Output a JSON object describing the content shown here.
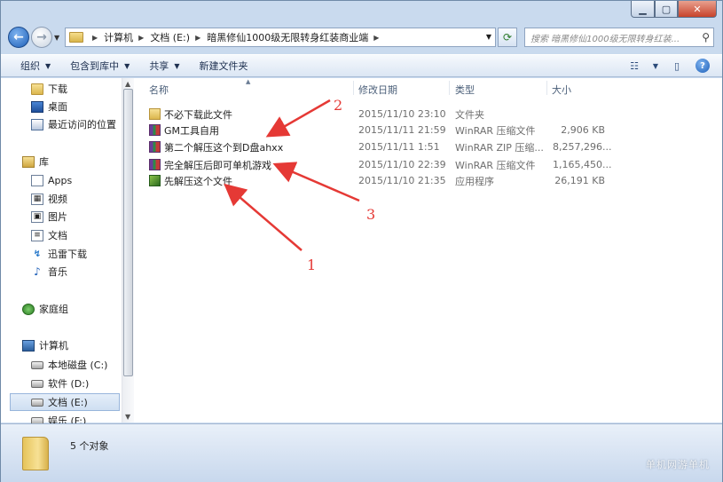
{
  "window": {
    "min_icon": "minimize-icon",
    "max_icon": "maximize-icon",
    "close_icon": "close-icon"
  },
  "nav": {
    "breadcrumbs": [
      "计算机",
      "文档 (E:)",
      "暗黑修仙1000级无限转身红装商业端"
    ],
    "search_placeholder": "搜索 暗黑修仙1000级无限转身红装..."
  },
  "toolbar": {
    "organize": "组织",
    "include_in_library": "包含到库中",
    "share": "共享",
    "new_folder": "新建文件夹"
  },
  "sidebar": {
    "downloads": "下载",
    "desktop": "桌面",
    "recent": "最近访问的位置",
    "libraries": "库",
    "apps": "Apps",
    "videos": "视频",
    "pictures": "图片",
    "documents": "文档",
    "thunder": "迅雷下载",
    "music": "音乐",
    "homegroup": "家庭组",
    "computer": "计算机",
    "drive_c": "本地磁盘 (C:)",
    "drive_d": "软件 (D:)",
    "drive_e": "文档 (E:)",
    "drive_f": "娱乐 (F:)"
  },
  "columns": {
    "name": "名称",
    "modified": "修改日期",
    "type": "类型",
    "size": "大小"
  },
  "files": [
    {
      "name": "不必下载此文件",
      "date": "2015/11/10 23:10",
      "type": "文件夹",
      "size": "",
      "icon": "folder-icon"
    },
    {
      "name": "GM工具自用",
      "date": "2015/11/11 21:59",
      "type": "WinRAR 压缩文件",
      "size": "2,906 KB",
      "icon": "rar-icon"
    },
    {
      "name": "第二个解压这个到D盘ahxx",
      "date": "2015/11/11 1:51",
      "type": "WinRAR ZIP 压缩...",
      "size": "8,257,296...",
      "icon": "rar-icon"
    },
    {
      "name": "完全解压后即可单机游戏",
      "date": "2015/11/10 22:39",
      "type": "WinRAR 压缩文件",
      "size": "1,165,450...",
      "icon": "rar-icon"
    },
    {
      "name": "先解压这个文件",
      "date": "2015/11/10 21:35",
      "type": "应用程序",
      "size": "26,191 KB",
      "icon": "exe-icon"
    }
  ],
  "annotations": {
    "label1": "1",
    "label2": "2",
    "label3": "3",
    "color": "#e53935"
  },
  "status": {
    "count": "5 个对象"
  },
  "watermark": "单机网游单机"
}
